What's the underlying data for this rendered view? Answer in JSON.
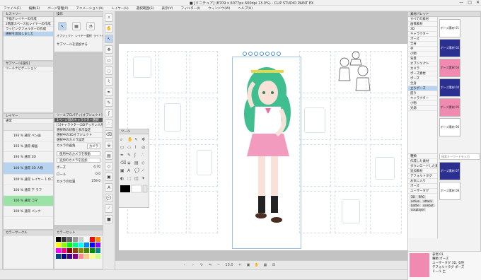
{
  "window": {
    "title": "■ [ミニチュア] (8709 x 6077px 600dpi 13.0%) - CLIP STUDIO PAINT EX",
    "controls": [
      "—",
      "□",
      "✕"
    ]
  },
  "menu": [
    "ファイル(F)",
    "編集(E)",
    "ページ管理(P)",
    "アニメーション(A)",
    "レイヤー(L)",
    "選択範囲(S)",
    "表示(V)",
    "フィルター(I)",
    "ウィンドウ(W)",
    "ヘルプ(H)"
  ],
  "left_panel": {
    "history_items": [
      "下描きレイヤーの作成",
      "2階層スペース化レイヤーの作成",
      "ラッピングフォルダーの作成",
      "選択を追加しました"
    ],
    "tool_property_title": "サブツール[操作]",
    "tool_property_label": "ツールナビゲーション",
    "layer_header": "レイヤー",
    "blend_mode": "通常",
    "layers": [
      {
        "label": "193 % 通常 ペン画"
      },
      {
        "label": "193 % 通常 線画"
      },
      {
        "label": "193 % 通常 2D"
      },
      {
        "label": "100 % 通常 3D 人物"
      },
      {
        "label": "100 % 通常 レイヤー 1 のコピー"
      },
      {
        "label": "100 % 通常 下 ラフ"
      },
      {
        "label": "100 % 通常 コマ"
      },
      {
        "label": "100 % 通常 バック"
      }
    ]
  },
  "operation_tool": {
    "title": "操作",
    "row1": "オブジェクト",
    "row2": "レイヤー選択",
    "row3": "ライトテーブル",
    "add_label": "サブツールを追加する"
  },
  "object_panel": {
    "title": "ツールプロパティ[オブジェクト]",
    "subtitle": "1ページ目のキャラクター選択",
    "rows": [
      "[1]キャラクター(3Dデッサン人形)",
      "選択時の状態と表示設定",
      "選択中の3Dオブジェクト",
      "選択中のカメラ設定"
    ],
    "camera_label": "カメラの画角",
    "camera_value": "カメラ",
    "buttons": [
      "使用中のカメラを移動",
      "追加のカメラを追加"
    ],
    "pose_label": "ポーズ",
    "pose_value": "4.70",
    "roll_label": "ロール",
    "roll_value": "0.0",
    "size_label": "カメラの位置",
    "size_value": "259.0"
  },
  "color_set": {
    "title": "カラーセット",
    "palette_name": "標準カラーセット"
  },
  "canvas": {
    "zoom": "13.0"
  },
  "material_panel": {
    "title": "素材パレット",
    "search_placeholder": "検索キーワードを入力",
    "tree": [
      "すべての素材",
      "画像素材",
      "3D",
      "キャラクター",
      "ポーズ",
      "全身",
      "手",
      "小物",
      "背景",
      "オブジェクト",
      "カメラ",
      "ポーズ素材",
      "ポーズ",
      "全身",
      "立ちポーズ",
      "座り",
      "キャラクター",
      "小物",
      "光源"
    ],
    "tags_header": "種類",
    "tags": [
      "作成した素材",
      "ダウンロードした素材",
      "追加素材",
      "デフォルトタグ",
      "お気に入り",
      "ポーズ",
      "ユーザータグ",
      "3D",
      "RPG",
      "action",
      "attack",
      "battle",
      "combat",
      "cosplayer"
    ],
    "thumbs": [
      "ポーズ素材 01",
      "ポーズ素材 02",
      "ポーズ素材 03",
      "ポーズ素材 04",
      "ポーズ素材 05",
      "ポーズ素材 06",
      "ポーズ素材 07",
      "ポーズ素材 08"
    ],
    "detail": {
      "name": "表現 01",
      "lines": [
        "種類 ポーズ",
        "ユーザータグ 3D, 女性",
        "デフォルトタグ ポーズ",
        "ドール 土"
      ]
    }
  },
  "floating_tools": {
    "title": "ツール"
  },
  "bottom_icons": [
    "prev-icon",
    "next-icon",
    "rotate-icon",
    "flip-icon",
    "zoom-out-icon",
    "zoom-in-icon",
    "fit-icon",
    "hand-icon"
  ]
}
